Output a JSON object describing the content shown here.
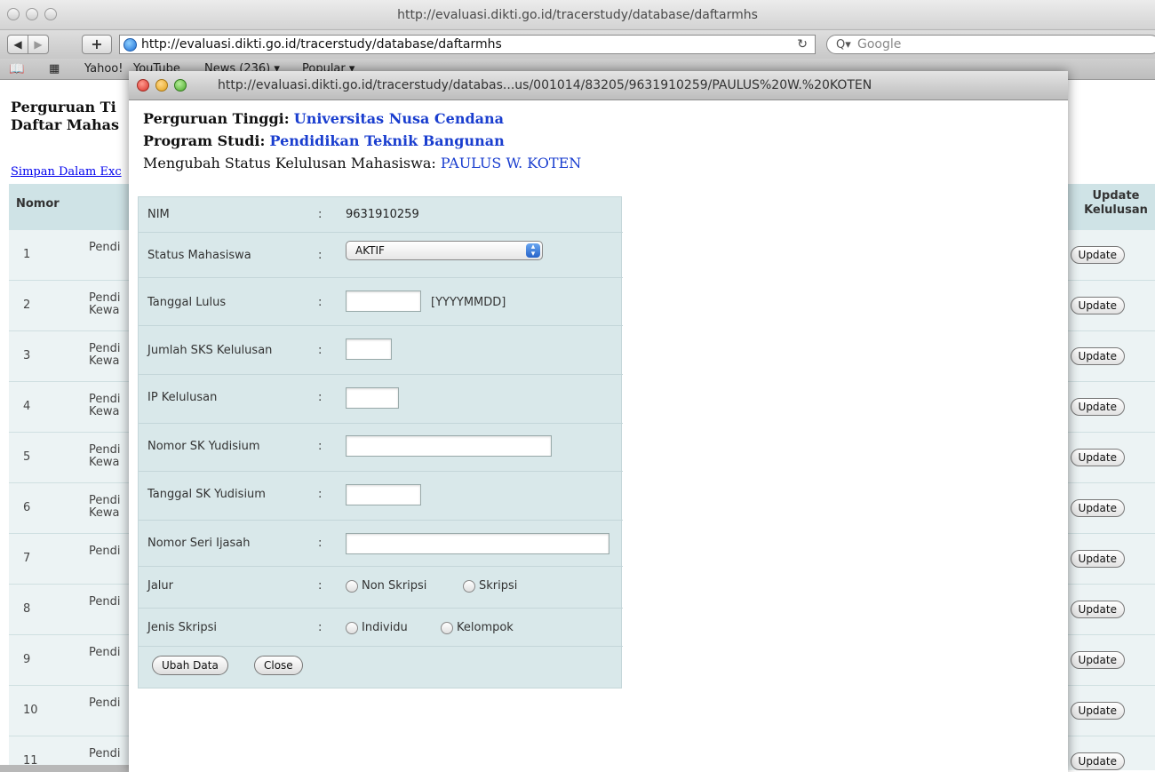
{
  "browser": {
    "window_title": "http://evaluasi.dikti.go.id/tracerstudy/database/daftarmhs",
    "url": "http://evaluasi.dikti.go.id/tracerstudy/database/daftarmhs",
    "search_placeholder": "Google",
    "back": "◀",
    "forward": "▶",
    "add": "+",
    "reload": "↻",
    "bookmarks": [
      "Yahoo!",
      "YouTube",
      "News (236) ▾",
      "Popular ▾"
    ]
  },
  "background_page": {
    "title_line1": "Perguruan Ti",
    "title_line2": "Daftar Mahas",
    "export_link": "Simpan Dalam Exc",
    "col_nomor": "Nomor",
    "col_update": "Update Kelulusan",
    "rows": [
      {
        "num": "1",
        "prog": "Pendi",
        "update": "Update"
      },
      {
        "num": "2",
        "prog": "Pendi Kewa",
        "update": "Update"
      },
      {
        "num": "3",
        "prog": "Pendi Kewa",
        "update": "Update"
      },
      {
        "num": "4",
        "prog": "Pendi Kewa",
        "update": "Update"
      },
      {
        "num": "5",
        "prog": "Pendi Kewa",
        "update": "Update"
      },
      {
        "num": "6",
        "prog": "Pendi Kewa",
        "update": "Update"
      },
      {
        "num": "7",
        "prog": "Pendi",
        "update": "Update"
      },
      {
        "num": "8",
        "prog": "Pendi",
        "update": "Update"
      },
      {
        "num": "9",
        "prog": "Pendi",
        "update": "Update"
      },
      {
        "num": "10",
        "prog": "Pendi",
        "update": "Update"
      },
      {
        "num": "11",
        "prog": "Pendi",
        "update": "Update"
      }
    ]
  },
  "popup": {
    "title": "http://evaluasi.dikti.go.id/tracerstudy/databas...us/001014/83205/9631910259/PAULUS%20W.%20KOTEN",
    "perguruan_label": "Perguruan Tinggi:",
    "perguruan_value": "Universitas Nusa Cendana",
    "prodi_label": "Program Studi:",
    "prodi_value": "Pendidikan Teknik Bangunan",
    "status_label": "Mengubah Status Kelulusan Mahasiswa:",
    "status_value": "PAULUS W. KOTEN",
    "form": {
      "colon": ":",
      "nim_label": "NIM",
      "nim_value": "9631910259",
      "status_mhs_label": "Status Mahasiswa",
      "status_mhs_value": "AKTIF",
      "tgl_lulus_label": "Tanggal Lulus",
      "tgl_lulus_value": "",
      "tgl_lulus_hint": "[YYYYMMDD]",
      "sks_label": "Jumlah SKS Kelulusan",
      "sks_value": "",
      "ip_label": "IP Kelulusan",
      "ip_value": "",
      "sk_label": "Nomor SK Yudisium",
      "sk_value": "",
      "tgl_sk_label": "Tanggal SK Yudisium",
      "tgl_sk_value": "",
      "ijasah_label": "Nomor Seri Ijasah",
      "ijasah_value": "",
      "jalur_label": "Jalur",
      "jalur_opt1": "Non Skripsi",
      "jalur_opt2": "Skripsi",
      "jenis_label": "Jenis Skripsi",
      "jenis_opt1": "Individu",
      "jenis_opt2": "Kelompok",
      "ubah_button": "Ubah Data",
      "close_button": "Close"
    }
  }
}
